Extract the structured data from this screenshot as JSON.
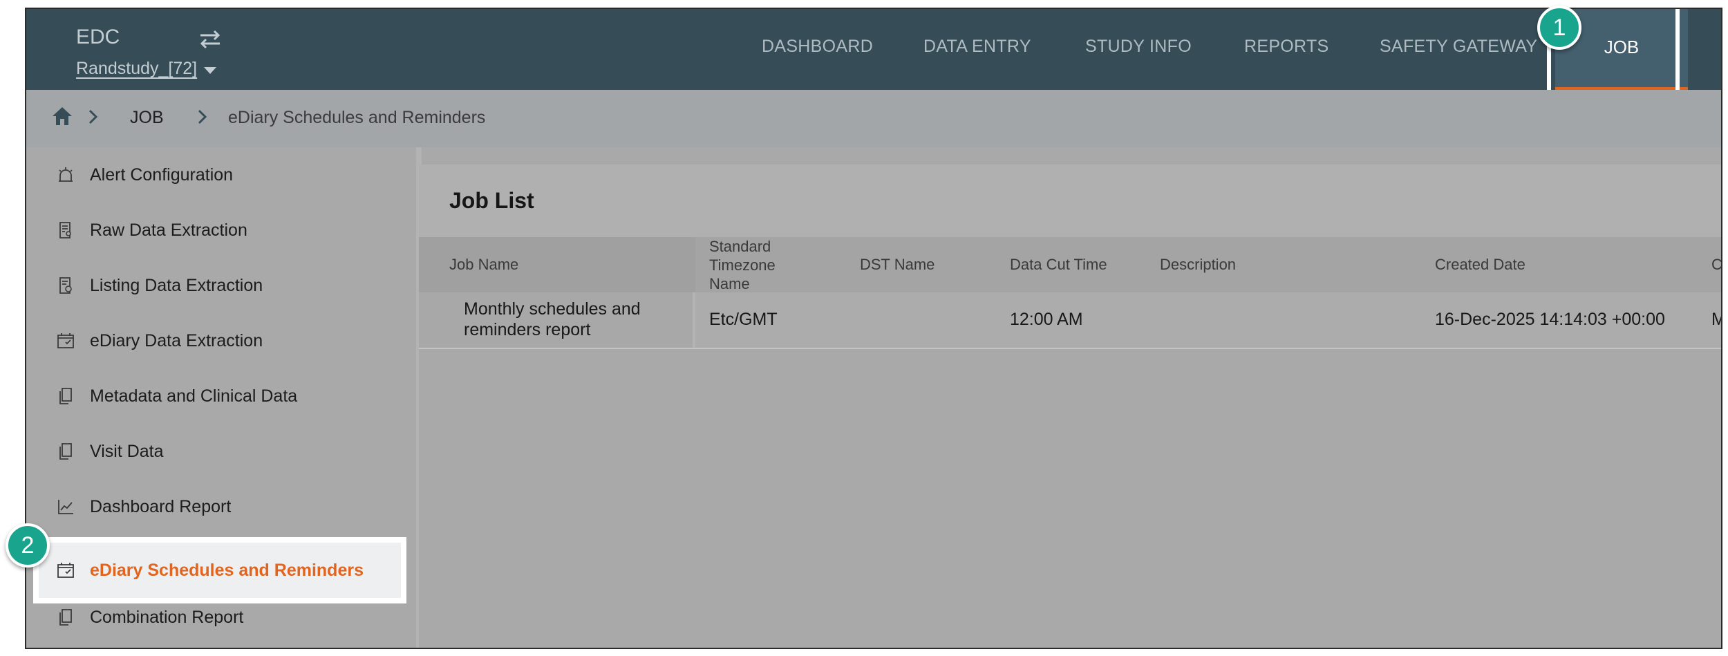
{
  "app": {
    "title": "EDC",
    "study": "Randstudy_[72]"
  },
  "nav": {
    "items": [
      "DASHBOARD",
      "DATA ENTRY",
      "STUDY INFO",
      "REPORTS",
      "SAFETY GATEWAY"
    ],
    "active": "JOB"
  },
  "breadcrumb": {
    "level1": "JOB",
    "level2": "eDiary Schedules and Reminders"
  },
  "sidebar": {
    "items": [
      {
        "label": "Alert Configuration",
        "icon": "alarm-icon"
      },
      {
        "label": "Raw Data Extraction",
        "icon": "document-search-icon"
      },
      {
        "label": "Listing Data Extraction",
        "icon": "document-clock-icon"
      },
      {
        "label": "eDiary Data Extraction",
        "icon": "calendar-check-icon"
      },
      {
        "label": "Metadata and Clinical Data",
        "icon": "copy-document-icon"
      },
      {
        "label": "Visit Data",
        "icon": "copy-icon"
      },
      {
        "label": "Dashboard Report",
        "icon": "line-chart-icon"
      },
      {
        "label": "eDiary Schedules and Reminders",
        "icon": "calendar-check-icon"
      },
      {
        "label": "Combination Report",
        "icon": "copy-document-icon"
      }
    ],
    "active_index": 7
  },
  "panel": {
    "title": "Job List",
    "columns": [
      "Job Name",
      "Standard Timezone Name",
      "DST Name",
      "Data Cut Time",
      "Description",
      "Created Date",
      "C"
    ],
    "rows": [
      {
        "job_name": "Monthly schedules and reminders report",
        "timezone": "Etc/GMT",
        "dst": "",
        "cut_time": "12:00 AM",
        "description": "",
        "created": "16-Dec-2025 14:14:03 +00:00",
        "extra": "M"
      }
    ]
  },
  "callouts": {
    "first": "1",
    "second": "2"
  },
  "colors": {
    "topbar": "#364d58",
    "accent": "#e2651f",
    "badge": "#19a58d"
  }
}
